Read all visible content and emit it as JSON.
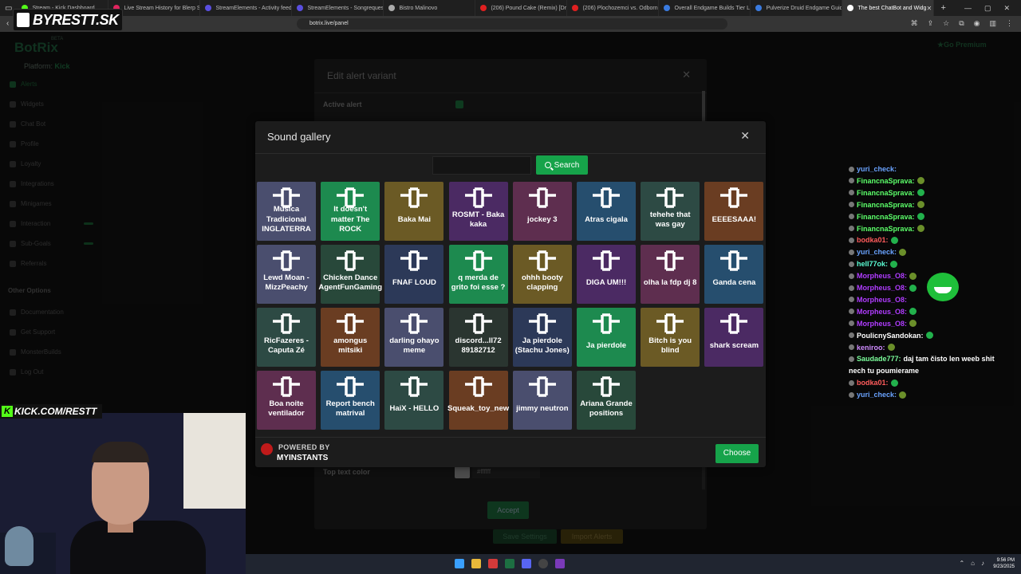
{
  "browser": {
    "tabs": [
      {
        "label": "Stream - Kick Dashboard",
        "color": "#53fc18",
        "active": false
      },
      {
        "label": "Live Stream History for Blerp Share",
        "color": "#e0245e",
        "active": false
      },
      {
        "label": "StreamElements - Activity feed",
        "color": "#5a4fe0",
        "active": false
      },
      {
        "label": "StreamElements - Songrequest",
        "color": "#5a4fe0",
        "active": false
      },
      {
        "label": "Bistro Malinovo",
        "color": "#aaaaaa",
        "active": false
      },
      {
        "label": "(206) Pound Cake (Remix) [Drake ft.",
        "color": "#e02020",
        "active": false
      },
      {
        "label": "(206) Plochozemci vs. Odborníci 2",
        "color": "#e02020",
        "active": false
      },
      {
        "label": "Overall Endgame Builds Tier List",
        "color": "#3a7be0",
        "active": false
      },
      {
        "label": "Pulverize Druid Endgame Guide D",
        "color": "#3a7be0",
        "active": false
      },
      {
        "label": "The best ChatBot and Widg",
        "color": "#ffffff",
        "active": true
      }
    ],
    "url": "botrix.live/panel"
  },
  "overlay": {
    "channel_logo": "BYRESTT.SK",
    "kick_handle": "KICK.COM/RESTT"
  },
  "page": {
    "brand": "BotRix",
    "brand_beta": "BETA",
    "platform_label": "Platform:",
    "platform_value": "Kick",
    "go_premium": "Go Premium",
    "sidebar": [
      {
        "label": "Alerts",
        "icon": "bell-icon",
        "green": true
      },
      {
        "label": "Widgets",
        "icon": "widget-icon",
        "green": false
      },
      {
        "label": "Chat Bot",
        "icon": "chat-icon",
        "green": false
      },
      {
        "label": "Profile",
        "icon": "profile-icon",
        "green": false
      },
      {
        "label": "Loyalty",
        "icon": "trophy-icon",
        "green": false
      },
      {
        "label": "Integrations",
        "icon": "plug-icon",
        "green": false
      },
      {
        "label": "Minigames",
        "icon": "gamepad-icon",
        "green": false
      },
      {
        "label": "Interaction",
        "icon": "interaction-icon",
        "green": false
      },
      {
        "label": "Sub-Goals",
        "icon": "music-icon",
        "green": false
      },
      {
        "label": "Referrals",
        "icon": "referrals-icon",
        "green": false
      }
    ],
    "other_options_title": "Other Options",
    "other_options": [
      {
        "label": "Documentation",
        "icon": "doc-icon"
      },
      {
        "label": "Get Support",
        "icon": "support-icon"
      },
      {
        "label": "MonsterBuilds",
        "icon": "monster-icon"
      },
      {
        "label": "Log Out",
        "icon": "logout-icon"
      }
    ]
  },
  "edit_modal": {
    "title": "Edit alert variant",
    "active_alert_label": "Active alert",
    "top_text_color_label": "Top text color",
    "top_text_color_value": "#ffffff",
    "accept_label": "Accept",
    "save_settings_label": "Save Settings",
    "import_alerts_label": "Import Alerts"
  },
  "sound_gallery": {
    "title": "Sound gallery",
    "search_placeholder": "",
    "search_label": "Search",
    "powered_by": "POWERED BY",
    "provider": "MYINSTANTS",
    "choose_label": "Choose",
    "tiles": [
      {
        "label": "Musica Tradicional INGLATERRA",
        "color": "#4a4e6e"
      },
      {
        "label": "It doesn't matter The ROCK",
        "color": "#1d8a4f"
      },
      {
        "label": "Baka Mai",
        "color": "#6b5a25"
      },
      {
        "label": "ROSMT - Baka kaka",
        "color": "#4b2a63"
      },
      {
        "label": "jockey 3",
        "color": "#5e2e4f"
      },
      {
        "label": "Atras cigala",
        "color": "#264e6e"
      },
      {
        "label": "tehehe that was gay",
        "color": "#2d4a44"
      },
      {
        "label": "EEEESAAA!",
        "color": "#6a3d22"
      },
      {
        "label": "Lewd Moan - MizzPeachy",
        "color": "#4a4e6e"
      },
      {
        "label": "Chicken Dance AgentFunGaming",
        "color": "#28483a"
      },
      {
        "label": "FNAF LOUD",
        "color": "#2c3958"
      },
      {
        "label": "q merda de grito foi esse ?",
        "color": "#1d8a4f"
      },
      {
        "label": "ohhh booty clapping",
        "color": "#6b5a25"
      },
      {
        "label": "DIGA UM!!!",
        "color": "#4b2a63"
      },
      {
        "label": "olha la fdp dj 8",
        "color": "#5e2e4f"
      },
      {
        "label": "Ganda cena",
        "color": "#264e6e"
      },
      {
        "label": "RicFazeres - Caputa Zé",
        "color": "#2d4a44"
      },
      {
        "label": "amongus mitsiki",
        "color": "#6a3d22"
      },
      {
        "label": "darling ohayo meme",
        "color": "#4a4e6e"
      },
      {
        "label": "discord...ll72 89182712",
        "color": "#2a3530"
      },
      {
        "label": "Ja pierdole (Stachu Jones)",
        "color": "#2c3958"
      },
      {
        "label": "Ja pierdole",
        "color": "#1d8a4f"
      },
      {
        "label": "Bitch is you blind",
        "color": "#6b5a25"
      },
      {
        "label": "shark scream",
        "color": "#4b2a63"
      },
      {
        "label": "Boa noite ventilador",
        "color": "#5e2e4f"
      },
      {
        "label": "Report bench matrival",
        "color": "#264e6e"
      },
      {
        "label": "HaiX - HELLO",
        "color": "#2d4a44"
      },
      {
        "label": "Squeak_toy_new",
        "color": "#6a3d22"
      },
      {
        "label": "jimmy neutron",
        "color": "#4a4e6e"
      },
      {
        "label": "Ariana Grande positions",
        "color": "#28483a"
      }
    ]
  },
  "chat": [
    {
      "user": "yuri_check:",
      "color": "#6aa3ff",
      "msg": "",
      "emote": false
    },
    {
      "user": "FinancnaSprava:",
      "color": "#5cff6a",
      "msg": "",
      "emote": true
    },
    {
      "user": "FinancnaSprava:",
      "color": "#5cff6a",
      "msg": "",
      "emote": true
    },
    {
      "user": "FinancnaSprava:",
      "color": "#5cff6a",
      "msg": "",
      "emote": true
    },
    {
      "user": "FinancnaSprava:",
      "color": "#5cff6a",
      "msg": "",
      "emote": true
    },
    {
      "user": "FinancnaSprava:",
      "color": "#5cff6a",
      "msg": "",
      "emote": true
    },
    {
      "user": "bodka01:",
      "color": "#ff5c5c",
      "msg": "",
      "emote": true
    },
    {
      "user": "yuri_check:",
      "color": "#6aa3ff",
      "msg": "",
      "emote": true
    },
    {
      "user": "hell77ok:",
      "color": "#5cffd6",
      "msg": "",
      "emote": true
    },
    {
      "user": "Morpheus_O8:",
      "color": "#b03cff",
      "msg": "",
      "emote": true
    },
    {
      "user": "Morpheus_O8:",
      "color": "#b03cff",
      "msg": "",
      "emote": true
    },
    {
      "user": "Morpheus_O8:",
      "color": "#b03cff",
      "msg": "",
      "emote": false
    },
    {
      "user": "Morpheus_O8:",
      "color": "#b03cff",
      "msg": "",
      "emote": true
    },
    {
      "user": "Morpheus_O8:",
      "color": "#b03cff",
      "msg": "",
      "emote": true
    },
    {
      "user": "PoulicnySandokan:",
      "color": "#ffffff",
      "msg": "",
      "emote": true
    },
    {
      "user": "keniroo:",
      "color": "#d08cff",
      "msg": "",
      "emote": true
    },
    {
      "user": "Saudade777:",
      "color": "#7cff9c",
      "msg": "daj tam čisto len weeb shit",
      "emote": false
    },
    {
      "user": "",
      "color": "#ffffff",
      "msg": "nech tu poumierame",
      "emote": false
    },
    {
      "user": "bodka01:",
      "color": "#ff5c5c",
      "msg": "",
      "emote": true
    },
    {
      "user": "yuri_check:",
      "color": "#6aa3ff",
      "msg": "",
      "emote": true
    }
  ],
  "taskbar": {
    "time": "9:56 PM",
    "date": "9/23/2025"
  }
}
